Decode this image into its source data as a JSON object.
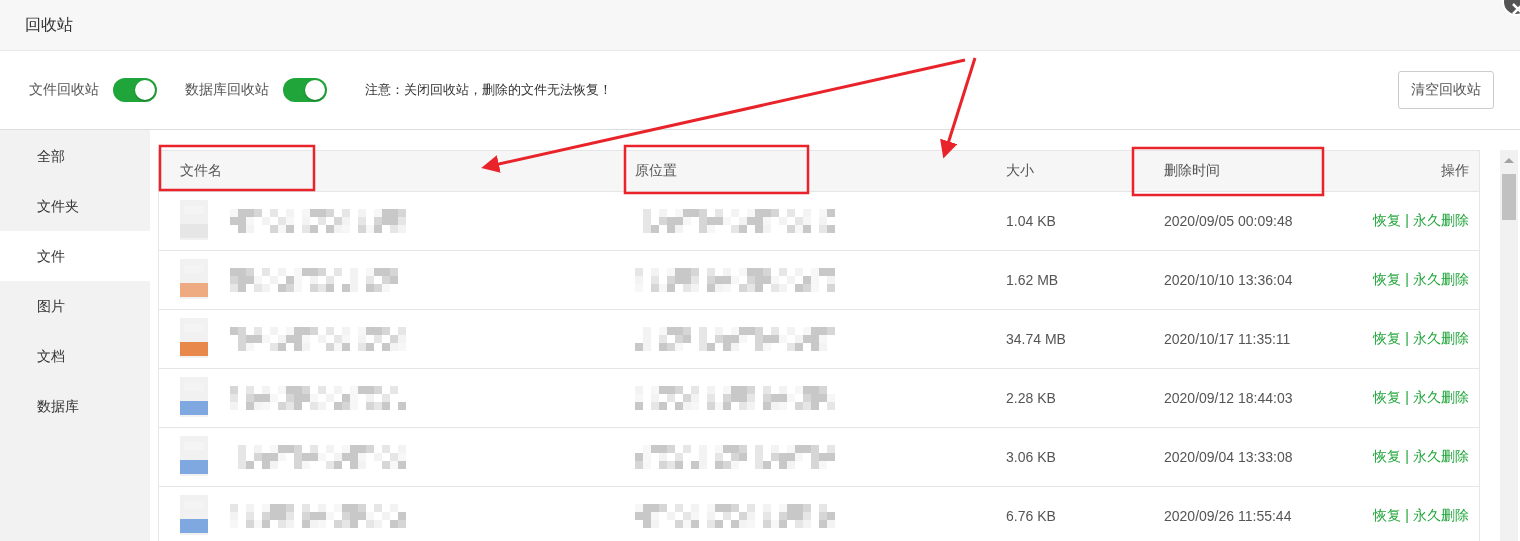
{
  "window": {
    "title": "回收站"
  },
  "toolbar": {
    "toggles": [
      {
        "label": "文件回收站",
        "on": true
      },
      {
        "label": "数据库回收站",
        "on": true
      }
    ],
    "notice": "注意：关闭回收站，删除的文件无法恢复！",
    "clear_button": "清空回收站"
  },
  "sidebar": {
    "items": [
      {
        "label": "全部",
        "selected": false
      },
      {
        "label": "文件夹",
        "selected": false
      },
      {
        "label": "文件",
        "selected": true
      },
      {
        "label": "图片",
        "selected": false
      },
      {
        "label": "文档",
        "selected": false
      },
      {
        "label": "数据库",
        "selected": false
      }
    ]
  },
  "table": {
    "columns": [
      "文件名",
      "原位置",
      "大小",
      "删除时间",
      "操作"
    ],
    "rows": [
      {
        "color": "#e6e6e6",
        "size": "1.04 KB",
        "deleted": "2020/09/05 00:09:48",
        "actions": [
          "恢复",
          "|",
          "永久删除"
        ]
      },
      {
        "color": "#eeaa80",
        "size": "1.62 MB",
        "deleted": "2020/10/10 13:36:04",
        "actions": [
          "恢复",
          "|",
          "永久删除"
        ]
      },
      {
        "color": "#e8884a",
        "size": "34.74 MB",
        "deleted": "2020/10/17 11:35:11",
        "actions": [
          "恢复",
          "|",
          "永久删除"
        ]
      },
      {
        "color": "#7fa8e0",
        "size": "2.28 KB",
        "deleted": "2020/09/12 18:44:03",
        "actions": [
          "恢复",
          "|",
          "永久删除"
        ]
      },
      {
        "color": "#7fa8e0",
        "size": "3.06 KB",
        "deleted": "2020/09/04 13:33:08",
        "actions": [
          "恢复",
          "|",
          "永久删除"
        ]
      },
      {
        "color": "#7fa8e0",
        "size": "6.76 KB",
        "deleted": "2020/09/26 11:55:44",
        "actions": [
          "恢复",
          "|",
          "永久删除"
        ]
      }
    ]
  }
}
